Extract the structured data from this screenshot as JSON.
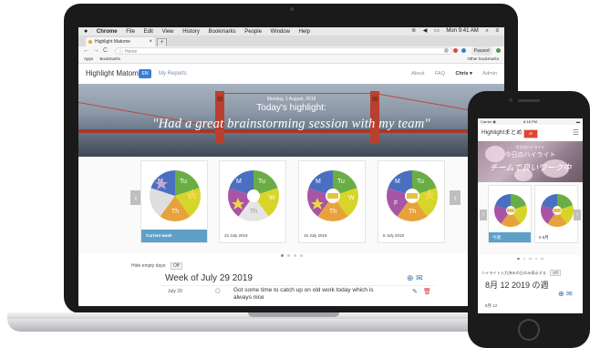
{
  "mac_menubar": {
    "items": [
      "Chrome",
      "File",
      "Edit",
      "View",
      "History",
      "Bookmarks",
      "People",
      "Window",
      "Help"
    ],
    "clock": "Mon 9:41 AM"
  },
  "browser": {
    "tab_title": "Highlight Matome",
    "tab_close": "×",
    "new_tab": "+",
    "nav_back": "←",
    "nav_forward": "→",
    "nav_reload": "C",
    "address": "Home",
    "profile_label": "Paused",
    "bookmarks": [
      "Apps",
      "Bookmarks"
    ],
    "other_bookmarks": "Other bookmarks"
  },
  "app_header": {
    "brand": "Highlight Matome",
    "lang": "EN",
    "my_reports": "My Reports",
    "links": [
      "About",
      "FAQ"
    ],
    "user": "Chris ▾",
    "admin": "Admin"
  },
  "hero": {
    "date": "Monday, 1 August, 2019",
    "title": "Today's highlight:",
    "quote": "\"Had a great brainstorming session with my team\""
  },
  "carousel": {
    "prev": "‹",
    "next": "›",
    "cards": [
      {
        "label": "Current week",
        "current": true
      },
      {
        "label": "22 July 2019",
        "current": false
      },
      {
        "label": "15 July 2019",
        "current": false
      },
      {
        "label": "8 July 2019",
        "current": false
      }
    ],
    "day_labels": {
      "Tu": "Tu",
      "W": "W",
      "Th": "Th",
      "M": "M",
      "F": "F"
    }
  },
  "weekly": {
    "hide_empty_label": "Hide empty days:",
    "hide_empty_value": "Off",
    "week_title": "Week of July 29 2019",
    "entry_date": "July 29",
    "entry_text": "Got some time to catch up on old work today which is always nice"
  },
  "phone": {
    "carrier": "Carrier ◉",
    "time": "8:18 PM",
    "brand": "Highlightまとめ",
    "lang": "JP",
    "hero_date": "今日のハイライト",
    "hero_title": "今日のハイライト",
    "hero_quote": "チームで良いワーク中",
    "cards": [
      {
        "label": "今週",
        "current": true
      },
      {
        "label": "5 8月",
        "current": false
      }
    ],
    "hide_label": "ハイライト入力済みの日のみ表示する",
    "hide_value": "Off",
    "week_title": "8月 12 2019 の週",
    "entry_date": "8月 12"
  },
  "colors": {
    "pie_green": "#6aad45",
    "pie_blue": "#4a6fc1",
    "pie_yellow": "#d7d52a",
    "pie_orange": "#e8a23b",
    "pie_purple": "#a855a5",
    "pie_empty": "#dedede",
    "accent_blue": "#3d7bd8",
    "current_week": "#5fa0c9"
  }
}
